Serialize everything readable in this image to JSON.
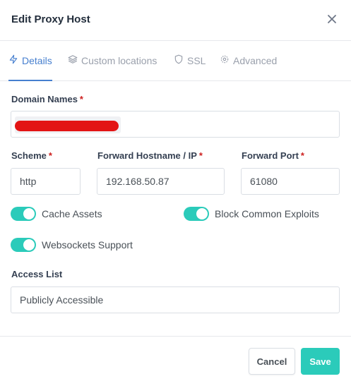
{
  "dialog": {
    "title": "Edit Proxy Host"
  },
  "tabs": [
    {
      "label": "Details",
      "icon": "bolt-icon",
      "active": true
    },
    {
      "label": "Custom locations",
      "icon": "layers-icon",
      "active": false
    },
    {
      "label": "SSL",
      "icon": "shield-icon",
      "active": false
    },
    {
      "label": "Advanced",
      "icon": "gear-icon",
      "active": false
    }
  ],
  "form": {
    "domain_names": {
      "label": "Domain Names",
      "required_mark": "*"
    },
    "scheme": {
      "label": "Scheme",
      "required_mark": "*",
      "value": "http"
    },
    "forward_hostname": {
      "label": "Forward Hostname / IP",
      "required_mark": "*",
      "value": "192.168.50.87"
    },
    "forward_port": {
      "label": "Forward Port",
      "required_mark": "*",
      "value": "61080"
    },
    "toggles": [
      {
        "label": "Cache Assets",
        "on": true
      },
      {
        "label": "Block Common Exploits",
        "on": true
      },
      {
        "label": "Websockets Support",
        "on": true
      }
    ],
    "access_list": {
      "label": "Access List",
      "value": "Publicly Accessible"
    }
  },
  "footer": {
    "cancel_label": "Cancel",
    "save_label": "Save"
  },
  "colors": {
    "accent": "#2bcbba",
    "tab_active": "#467fcf",
    "required": "#cd201f",
    "redaction": "#e31414"
  }
}
